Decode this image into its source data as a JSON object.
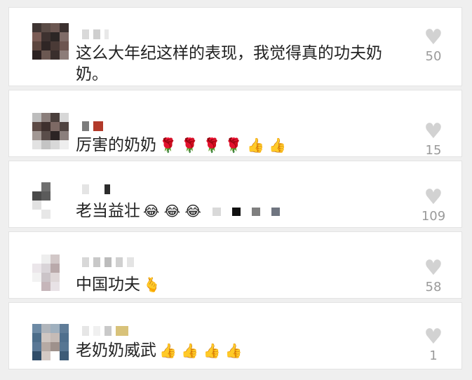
{
  "comments": [
    {
      "text": "这么大年纪这样的表现，我觉得真的功夫奶奶。",
      "likes": "50",
      "emoji": ""
    },
    {
      "text": "厉害的奶奶",
      "likes": "15",
      "emoji": "🌹 🌹 🌹 🌹 👍 👍"
    },
    {
      "text": "老当益壮",
      "likes": "109",
      "emoji": "😂 😂 😂"
    },
    {
      "text": "中国功夫",
      "likes": "58",
      "emoji": "🫰"
    },
    {
      "text": "老奶奶威武",
      "likes": "1",
      "emoji": "👍 👍 👍 👍"
    }
  ],
  "icons": {
    "like": "heart-icon"
  },
  "colors": {
    "card_bg": "#ffffff",
    "page_bg": "#efefef",
    "heart": "#d2d2d2",
    "count": "#9a9a9a",
    "text": "#222222"
  }
}
